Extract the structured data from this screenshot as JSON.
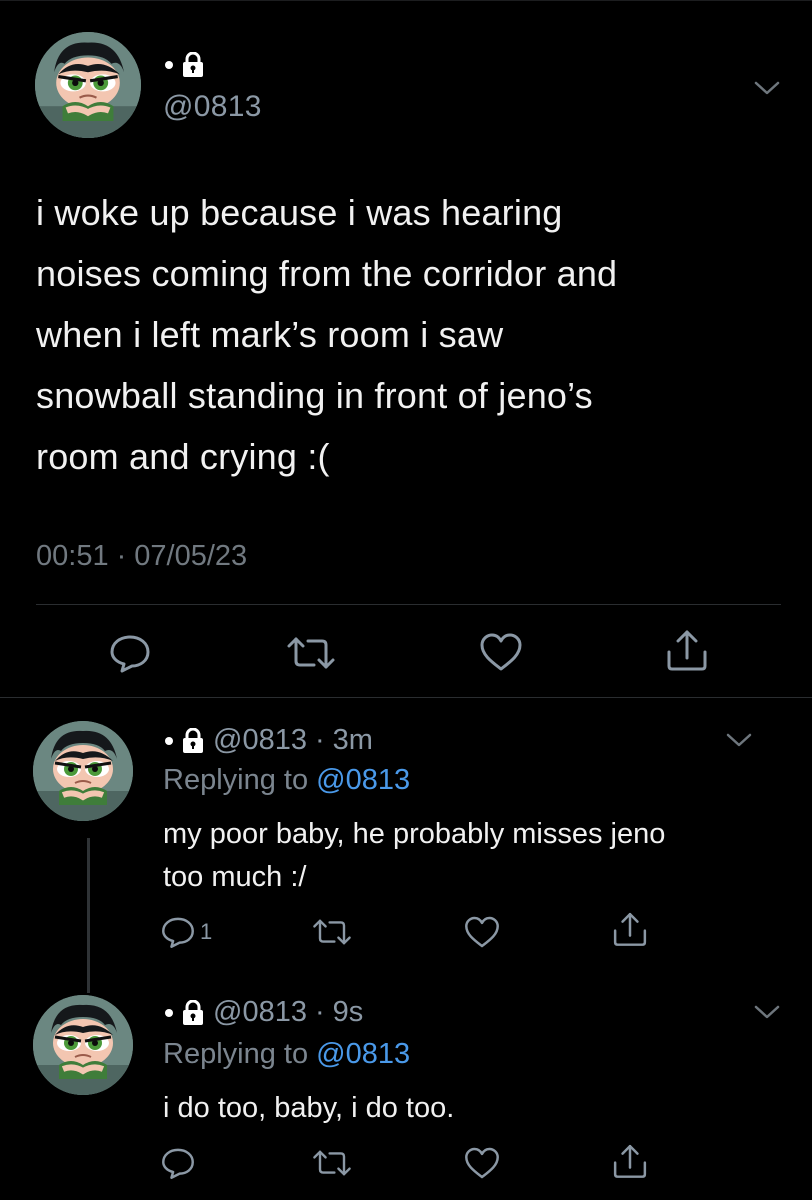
{
  "main_tweet": {
    "display_name": ".",
    "handle": "@0813",
    "text": "i woke up because i was hearing\nnoises coming from the corridor and\nwhen i left mark’s room i saw\nsnowball standing in front of jeno’s\nroom and crying :(",
    "time": "00:51",
    "separator": "·",
    "date": "07/05/23",
    "icons": [
      "reply-icon",
      "retweet-icon",
      "like-icon",
      "share-icon"
    ]
  },
  "replies": [
    {
      "display_name": ".",
      "handle": "@0813",
      "separator": "·",
      "time": "3m",
      "replying_prefix": "Replying to",
      "replying_to": "@0813",
      "text": "my poor baby, he probably misses jeno\ntoo much :/",
      "reply_count": "1"
    },
    {
      "display_name": ".",
      "handle": "@0813",
      "separator": "·",
      "time": "9s",
      "replying_prefix": "Replying to",
      "replying_to": "@0813",
      "text": "i do too, baby, i do too.",
      "reply_count": ""
    }
  ],
  "colors": {
    "background": "#000000",
    "text": "#f1f1f1",
    "muted": "#8b98a5",
    "link": "#4a99e9"
  }
}
